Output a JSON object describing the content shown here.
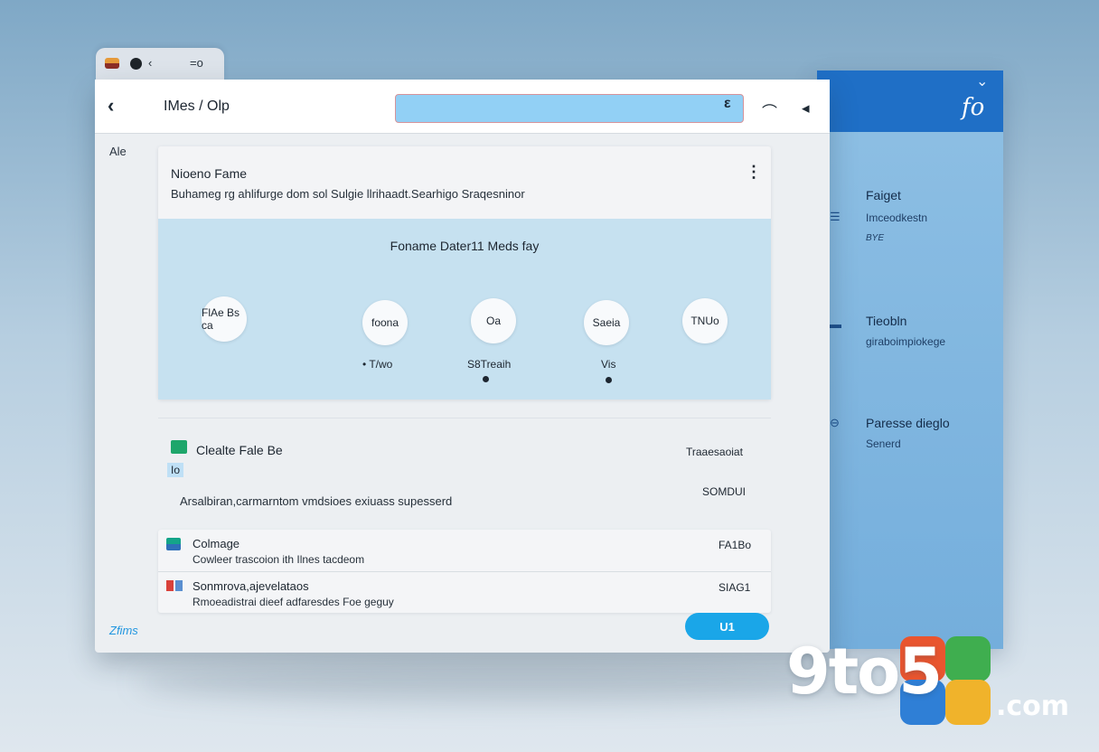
{
  "tab": {
    "label": "=o"
  },
  "window": {
    "title": "IMes / Olp",
    "search": {
      "value": "",
      "placeholder": ""
    },
    "left_label": "Ale"
  },
  "card": {
    "title": "Nioeno Fame",
    "description": "Buhameg rg ahlifurge dom sol Sulgie llrihaadt.Searhigo Sraqesninor",
    "feature_heading": "Foname Dater11 Meds fay",
    "features": [
      {
        "circle": "FlAe Bs ca",
        "label": ""
      },
      {
        "circle": "foona",
        "label": "• T/wo"
      },
      {
        "circle": "Oa",
        "label": "S8Treaih"
      },
      {
        "circle": "Saeia",
        "label": "Vis"
      },
      {
        "circle": "TNUo",
        "label": ""
      }
    ]
  },
  "section": {
    "title": "Clealte Fale Be",
    "tag": "Io",
    "right_1": "Traaesaoiat",
    "right_2": "SOMDUI",
    "description": "Arsalbiran,carmarntom vmdsioes exiuass supesserd"
  },
  "list": [
    {
      "title": "Colmage",
      "subtitle": "Cowleer trascoion ith Ilnes tacdeom",
      "value": "FA1Bo"
    },
    {
      "title": "Sonmrova,ajevelataos",
      "subtitle": "Rmoeadistrai dieef adfaresdes Foe geguy",
      "value": "SIAG1"
    }
  ],
  "footer": {
    "link": "Zfims",
    "button": "U1"
  },
  "side_panel": {
    "items": [
      {
        "title": "Faiget",
        "subtitle": "Imceodkestn",
        "meta": "BYE"
      },
      {
        "title": "Tieobln",
        "subtitle": "giraboimpiokege",
        "meta": ""
      },
      {
        "title": "Paresse dieglo",
        "subtitle": "Senerd",
        "meta": ""
      }
    ]
  },
  "watermark": {
    "text": "9to5",
    "suffix": ".com"
  },
  "colors": {
    "accent": "#1aa6e8",
    "side_header": "#1f6fc6",
    "search_fill": "#92d0f5",
    "feature_area": "#c6e1f0"
  },
  "icons": {
    "back": "back-arrow-icon",
    "search": "search-icon",
    "toolbar_1": "share-icon",
    "toolbar_2": "pin-icon",
    "card_menu": "more-vertical-icon"
  }
}
